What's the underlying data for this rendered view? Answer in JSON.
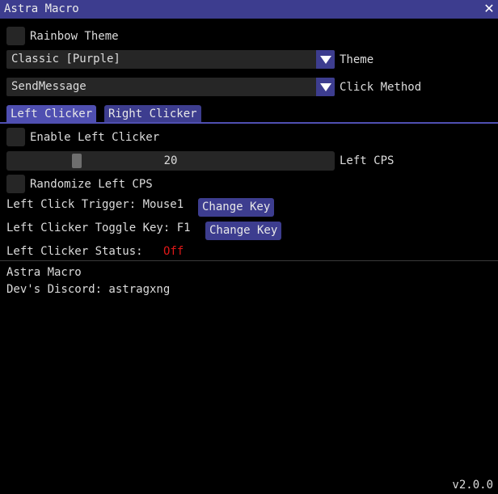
{
  "window": {
    "title": "Astra Macro",
    "close_glyph": "✕",
    "version": "v2.0.0"
  },
  "colors": {
    "accent": "#3d3d8f",
    "accent_active": "#4f4fb1",
    "frame_bg": "#262626",
    "status_off": "#e01818"
  },
  "rainbow_theme": {
    "label": "Rainbow Theme",
    "checked": false
  },
  "theme": {
    "selected": "Classic [Purple]",
    "label": "Theme",
    "arrow_icon": "chevron-down-icon"
  },
  "click_method": {
    "selected": "SendMessage",
    "label": "Click Method",
    "arrow_icon": "chevron-down-icon"
  },
  "tabs": [
    {
      "label": "Left Clicker",
      "active": true
    },
    {
      "label": "Right Clicker",
      "active": false
    }
  ],
  "left_clicker": {
    "enable_label": "Enable Left Clicker",
    "enabled": false,
    "cps_value": "20",
    "cps_label": "Left CPS",
    "cps_fraction": 0.2,
    "randomize_label": "Randomize Left CPS",
    "randomize": false,
    "trigger_label": "Left Click Trigger: Mouse1",
    "trigger_button": "Change Key",
    "toggle_label": "Left Clicker Toggle Key: F1",
    "toggle_button": "Change Key",
    "status_label": "Left Clicker Status:",
    "status_value": "Off"
  },
  "footer": {
    "line1": "Astra Macro",
    "line2": "Dev's Discord: astragxng"
  }
}
